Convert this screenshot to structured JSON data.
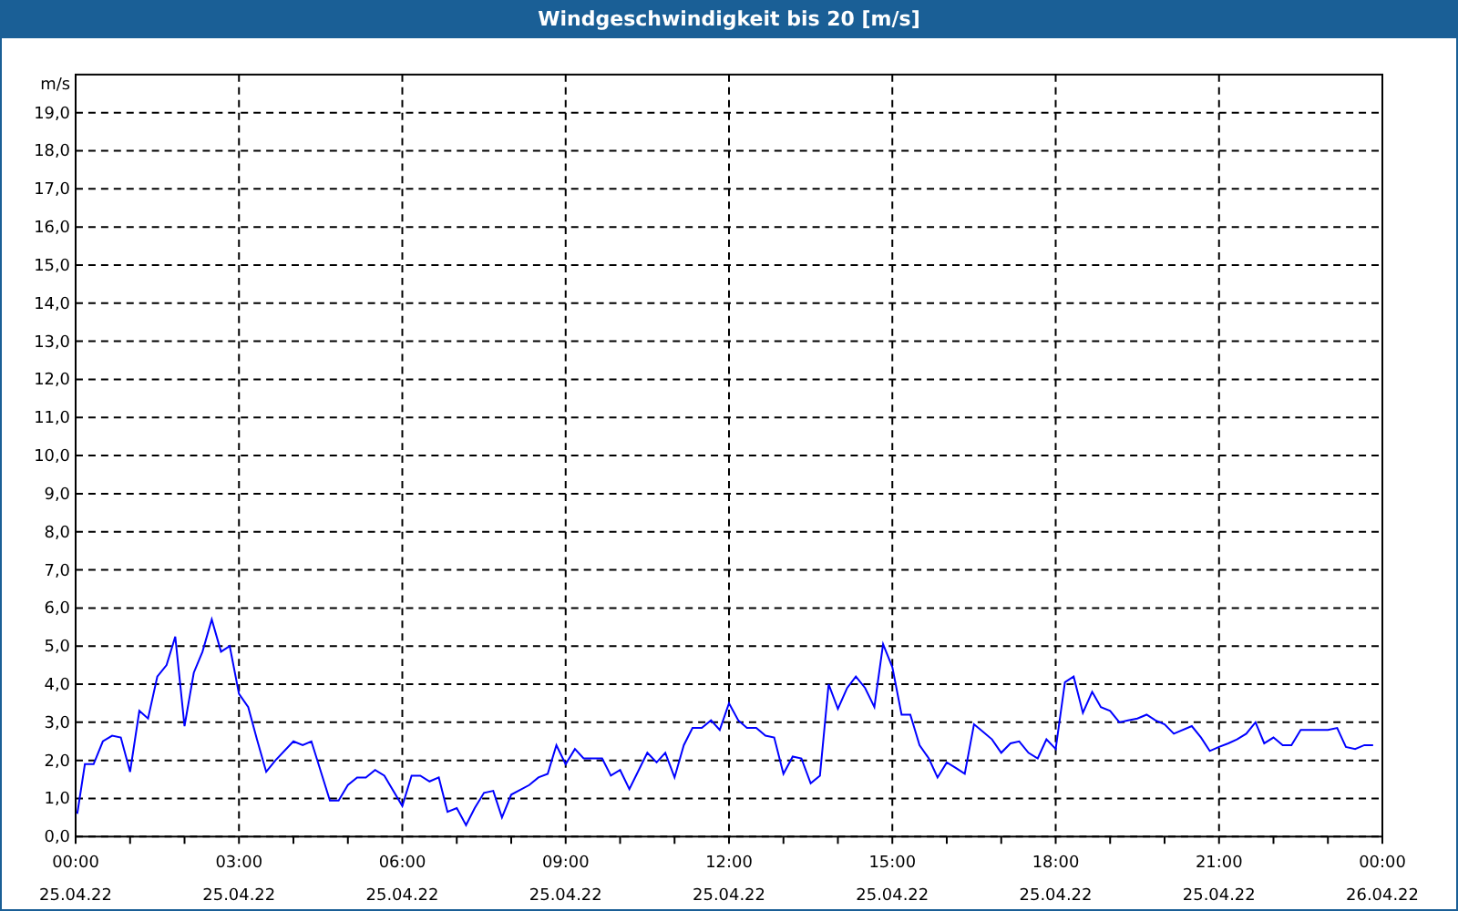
{
  "window": {
    "title": "Windgeschwindigkeit bis 20 [m/s]"
  },
  "x_axis_dates": [
    "25.04.22",
    "25.04.22",
    "25.04.22",
    "25.04.22",
    "25.04.22",
    "25.04.22",
    "25.04.22",
    "25.04.22",
    "26.04.22"
  ],
  "chart_data": {
    "type": "line",
    "grid": true,
    "ylabel": "m/s",
    "xlim": [
      0,
      24
    ],
    "ylim": [
      0,
      20
    ],
    "x": [
      0.03,
      0.17,
      0.33,
      0.5,
      0.67,
      0.83,
      1.0,
      1.17,
      1.33,
      1.5,
      1.67,
      1.83,
      2.0,
      2.17,
      2.33,
      2.5,
      2.67,
      2.83,
      3.0,
      3.17,
      3.33,
      3.5,
      3.67,
      4.0,
      4.17,
      4.33,
      4.67,
      4.83,
      5.0,
      5.17,
      5.33,
      5.5,
      5.67,
      6.0,
      6.17,
      6.33,
      6.5,
      6.67,
      6.83,
      7.0,
      7.17,
      7.33,
      7.5,
      7.67,
      7.83,
      8.0,
      8.33,
      8.5,
      8.67,
      8.83,
      9.0,
      9.17,
      9.33,
      9.67,
      9.83,
      10.0,
      10.17,
      10.5,
      10.67,
      10.83,
      11.0,
      11.17,
      11.33,
      11.5,
      11.67,
      11.83,
      12.0,
      12.17,
      12.33,
      12.5,
      12.67,
      12.83,
      13.0,
      13.17,
      13.33,
      13.5,
      13.67,
      13.83,
      14.0,
      14.17,
      14.33,
      14.5,
      14.67,
      14.83,
      15.0,
      15.17,
      15.33,
      15.5,
      15.67,
      15.83,
      16.0,
      16.17,
      16.33,
      16.5,
      16.67,
      16.83,
      17.0,
      17.17,
      17.33,
      17.5,
      17.67,
      17.83,
      18.0,
      18.17,
      18.33,
      18.5,
      18.67,
      18.83,
      19.0,
      19.17,
      19.33,
      19.5,
      19.67,
      19.83,
      20.0,
      20.17,
      20.5,
      20.67,
      20.83,
      21.0,
      21.17,
      21.33,
      21.5,
      21.67,
      21.83,
      22.0,
      22.17,
      22.33,
      22.5,
      22.67,
      23.0,
      23.17,
      23.33,
      23.5,
      23.67,
      23.83
    ],
    "series": [
      {
        "color": "#0000ff",
        "values": [
          0.6,
          1.9,
          1.9,
          2.5,
          2.65,
          2.6,
          1.7,
          3.3,
          3.1,
          4.2,
          4.5,
          5.25,
          2.9,
          4.3,
          4.85,
          5.7,
          4.85,
          5.0,
          3.75,
          3.4,
          2.55,
          1.7,
          2.0,
          2.5,
          2.4,
          2.5,
          0.95,
          0.95,
          1.35,
          1.55,
          1.55,
          1.75,
          1.6,
          0.8,
          1.6,
          1.6,
          1.45,
          1.55,
          0.65,
          0.75,
          0.3,
          0.75,
          1.15,
          1.2,
          0.5,
          1.1,
          1.35,
          1.55,
          1.65,
          2.4,
          1.9,
          2.3,
          2.05,
          2.05,
          1.6,
          1.75,
          1.25,
          2.2,
          1.95,
          2.2,
          1.55,
          2.4,
          2.85,
          2.85,
          3.05,
          2.8,
          3.5,
          3.05,
          2.85,
          2.85,
          2.65,
          2.6,
          1.65,
          2.1,
          2.05,
          1.4,
          1.6,
          4.0,
          3.35,
          3.9,
          4.2,
          3.9,
          3.4,
          5.05,
          4.45,
          3.2,
          3.2,
          2.4,
          2.05,
          1.55,
          1.95,
          1.8,
          1.65,
          2.95,
          2.75,
          2.55,
          2.2,
          2.45,
          2.5,
          2.2,
          2.05,
          2.55,
          2.3,
          4.05,
          4.2,
          3.25,
          3.8,
          3.4,
          3.3,
          3.0,
          3.05,
          3.1,
          3.2,
          3.05,
          2.95,
          2.7,
          2.9,
          2.6,
          2.25,
          2.35,
          2.45,
          2.55,
          2.7,
          3.0,
          2.45,
          2.6,
          2.4,
          2.4,
          2.8,
          2.8,
          2.8,
          2.85,
          2.35,
          2.3,
          2.4,
          2.4
        ]
      }
    ],
    "xticks": [
      {
        "value": 0,
        "label": "00:00"
      },
      {
        "value": 3,
        "label": "03:00"
      },
      {
        "value": 6,
        "label": "06:00"
      },
      {
        "value": 9,
        "label": "09:00"
      },
      {
        "value": 12,
        "label": "12:00"
      },
      {
        "value": 15,
        "label": "15:00"
      },
      {
        "value": 18,
        "label": "18:00"
      },
      {
        "value": 21,
        "label": "21:00"
      },
      {
        "value": 24,
        "label": "00:00"
      }
    ],
    "yticks": [
      {
        "value": 0,
        "label": "0,0"
      },
      {
        "value": 1,
        "label": "1,0"
      },
      {
        "value": 2,
        "label": "2,0"
      },
      {
        "value": 3,
        "label": "3,0"
      },
      {
        "value": 4,
        "label": "4,0"
      },
      {
        "value": 5,
        "label": "5,0"
      },
      {
        "value": 6,
        "label": "6,0"
      },
      {
        "value": 7,
        "label": "7,0"
      },
      {
        "value": 8,
        "label": "8,0"
      },
      {
        "value": 9,
        "label": "9,0"
      },
      {
        "value": 10,
        "label": "10,0"
      },
      {
        "value": 11,
        "label": "11,0"
      },
      {
        "value": 12,
        "label": "12,0"
      },
      {
        "value": 13,
        "label": "13,0"
      },
      {
        "value": 14,
        "label": "14,0"
      },
      {
        "value": 15,
        "label": "15,0"
      },
      {
        "value": 16,
        "label": "16,0"
      },
      {
        "value": 17,
        "label": "17,0"
      },
      {
        "value": 18,
        "label": "18,0"
      },
      {
        "value": 19,
        "label": "19,0"
      }
    ]
  }
}
